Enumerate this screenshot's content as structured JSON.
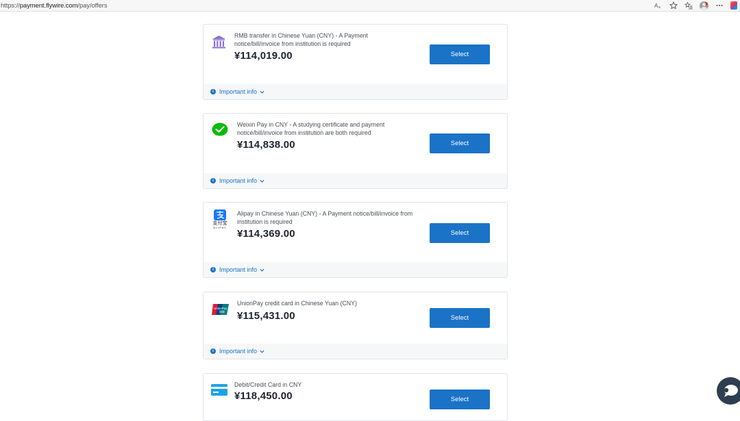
{
  "browser": {
    "url_scheme": "https://",
    "url_host": "payment.flywire.com",
    "url_path": "/pay/offers"
  },
  "offers": [
    {
      "title": "RMB transfer in Chinese Yuan (CNY) - A Payment notice/bill/invoice from institution is required",
      "amount": "¥114,019.00",
      "button": "Select",
      "info": "Important info",
      "icon": "bank-icon"
    },
    {
      "title": "Weixin Pay in CNY - A studying certificate and payment notice/bill/invoice from institution are both required",
      "amount": "¥114,838.00",
      "button": "Select",
      "info": "Important info",
      "icon": "wechat-icon"
    },
    {
      "title": "Alipay in Chinese Yuan (CNY) - A Payment notice/bill/invoice from institution is required",
      "amount": "¥114,369.00",
      "button": "Select",
      "info": "Important info",
      "icon": "alipay-icon",
      "icon_text": "支付宝",
      "icon_subtext": "ALIPAY"
    },
    {
      "title": "UnionPay credit card in Chinese Yuan (CNY)",
      "amount": "¥115,431.00",
      "button": "Select",
      "info": "Important info",
      "icon": "unionpay-icon",
      "icon_text": "UnionPay",
      "icon_subtext": "银联"
    },
    {
      "title": "Debit/Credit Card in CNY",
      "amount": "¥118,450.00",
      "button": "Select",
      "icon": "credit-card-icon"
    }
  ],
  "colors": {
    "primary": "#1a73c7",
    "wechat": "#09bb07",
    "alipay": "#1677ff",
    "bank": "#8a6fd6"
  }
}
